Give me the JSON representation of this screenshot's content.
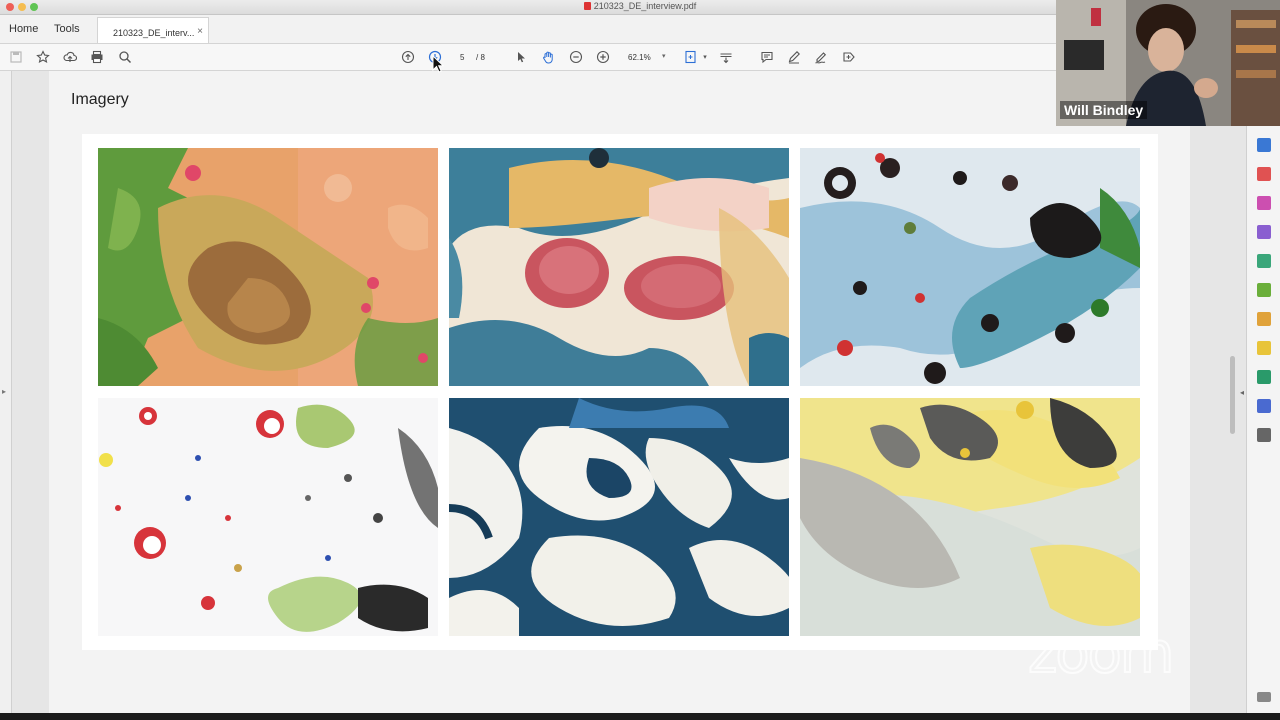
{
  "window": {
    "title": "210323_DE_interview.pdf"
  },
  "tabs": {
    "home": "Home",
    "tools": "Tools",
    "document": "210323_DE_interv...",
    "close": "×"
  },
  "toolbar": {
    "page_current": "5",
    "page_total": "/ 8",
    "zoom": "62.1%"
  },
  "document": {
    "heading": "Imagery",
    "images": [
      {
        "label": "orange-green-marbling"
      },
      {
        "label": "teal-cream-red-marbling"
      },
      {
        "label": "blue-black-marbling"
      },
      {
        "label": "white-red-speckle"
      },
      {
        "label": "dark-blue-swirl"
      },
      {
        "label": "yellow-grey-crackle"
      }
    ]
  },
  "video": {
    "participant_name": "Will Bindley"
  },
  "watermark": {
    "text": "zoom"
  },
  "colors": {
    "accent": "#2d6fd6",
    "pane_icon": "#3a78d4"
  }
}
